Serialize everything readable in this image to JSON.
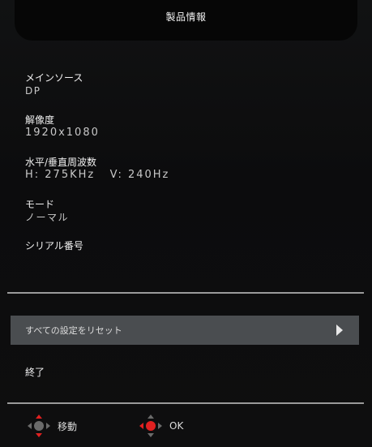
{
  "header": {
    "title": "製品情報"
  },
  "info": {
    "main_source": {
      "label": "メインソース",
      "value": "DP"
    },
    "resolution": {
      "label": "解像度",
      "value": "1920x1080"
    },
    "frequency": {
      "label": "水平/垂直周波数",
      "value": "H: 275KHz   V: 240Hz"
    },
    "mode": {
      "label": "モード",
      "value": "ノーマル"
    },
    "serial": {
      "label": "シリアル番号",
      "value": ""
    }
  },
  "menu": {
    "reset_label": "すべての設定をリセット",
    "exit_label": "終了"
  },
  "legend": {
    "move_label": "移動",
    "ok_label": "OK"
  },
  "colors": {
    "highlight_bar": "#4a4d50",
    "dpad_red": "#e02020",
    "dpad_grey": "#6a6a6a"
  }
}
